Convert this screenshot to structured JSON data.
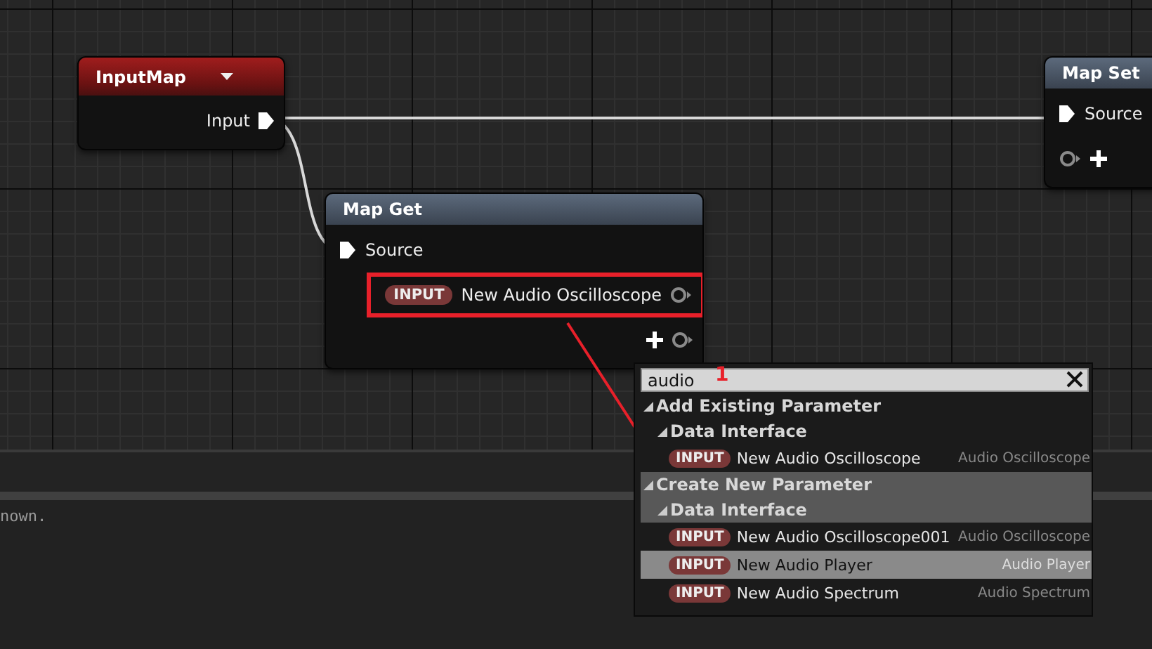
{
  "graph": {
    "nodes": [
      {
        "title": "InputMap",
        "kind": "input_map",
        "dropdown": true,
        "pins": [
          {
            "kind": "exec_out",
            "label": "Input"
          }
        ]
      },
      {
        "title": "Map Get",
        "kind": "map",
        "dropdown": false,
        "pins": [
          {
            "kind": "exec_in",
            "label": "Source"
          },
          {
            "kind": "param_out",
            "tag": "INPUT",
            "label": "New Audio Oscilloscope",
            "highlighted": true
          },
          {
            "kind": "add_out"
          }
        ]
      },
      {
        "title": "Map Set",
        "kind": "map",
        "dropdown": false,
        "pins": [
          {
            "kind": "exec_in",
            "label": "Source"
          },
          {
            "kind": "add_in"
          }
        ]
      }
    ],
    "annotation_number": "1"
  },
  "menu": {
    "search": {
      "value": "audio"
    },
    "sections": [
      {
        "label": "Add Existing Parameter",
        "expanded": true,
        "highlighted": false,
        "children": [
          {
            "label": "Data Interface",
            "expanded": true,
            "highlighted": false,
            "items": [
              {
                "tag": "INPUT",
                "name": "New Audio Oscilloscope",
                "type": "Audio Oscilloscope",
                "selected": false
              }
            ]
          }
        ]
      },
      {
        "label": "Create New Parameter",
        "expanded": true,
        "highlighted": true,
        "children": [
          {
            "label": "Data Interface",
            "expanded": true,
            "highlighted": true,
            "items": [
              {
                "tag": "INPUT",
                "name": "New Audio Oscilloscope001",
                "type": "Audio Oscilloscope",
                "selected": false
              },
              {
                "tag": "INPUT",
                "name": "New Audio Player",
                "type": "Audio Player",
                "selected": true
              },
              {
                "tag": "INPUT",
                "name": "New Audio Spectrum",
                "type": "Audio Spectrum",
                "selected": false
              }
            ]
          }
        ]
      }
    ]
  },
  "log": {
    "lines": [
      "nown."
    ]
  }
}
